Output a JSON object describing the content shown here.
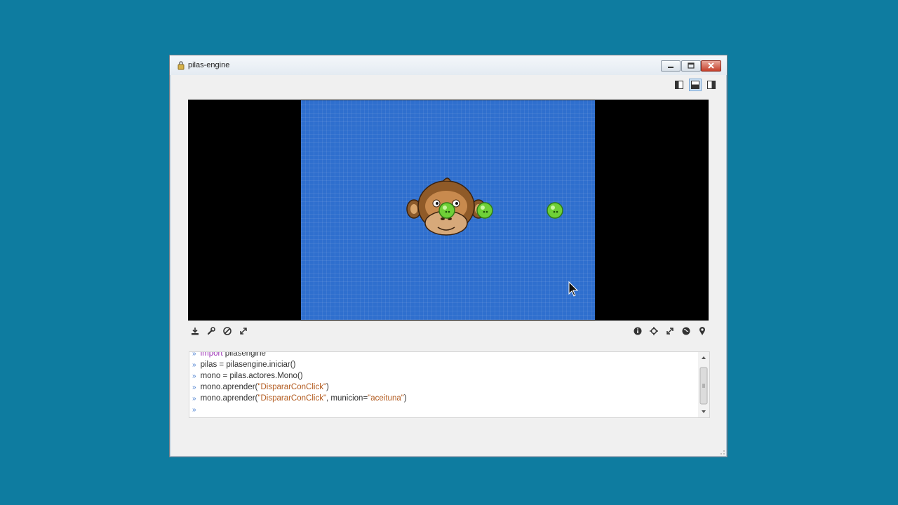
{
  "window": {
    "title": "pilas-engine",
    "minimize_icon": "minimize-icon",
    "maximize_icon": "maximize-icon",
    "close_icon": "close-icon"
  },
  "layout_buttons": [
    "layout-left-icon",
    "layout-bottom-icon",
    "layout-right-icon"
  ],
  "toolbar_left": [
    "download-icon",
    "wrench-icon",
    "stop-icon",
    "fullscreen-icon"
  ],
  "toolbar_right": [
    "info-icon",
    "crosshair-icon",
    "expand-icon",
    "globe-icon",
    "pin-icon"
  ],
  "scene": {
    "background_color": "#2f6fce",
    "actors": [
      "monkey",
      "olive",
      "olive",
      "olive"
    ]
  },
  "console": {
    "lines": [
      {
        "prompt": "»",
        "keyword": "import",
        "text": " pilasengine"
      },
      {
        "prompt": "»",
        "text": "pilas = pilasengine.iniciar()"
      },
      {
        "prompt": "»",
        "text": "mono = pilas.actores.Mono()"
      },
      {
        "prompt": "»",
        "pre": "mono.aprender(",
        "str1": "\"DispararConClick\"",
        "post": ")"
      },
      {
        "prompt": "»",
        "pre": "mono.aprender(",
        "str1": "\"DispararConClick\"",
        "mid": ", municion=",
        "str2": "\"aceituna\"",
        "post": ")"
      },
      {
        "prompt": "»",
        "text": ""
      }
    ]
  }
}
